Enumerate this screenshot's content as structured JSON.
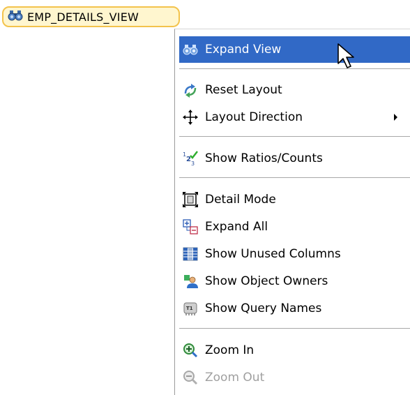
{
  "node": {
    "label": "EMP_DETAILS_VIEW",
    "icon": "binoculars-icon"
  },
  "menu": {
    "expand_view": "Expand View",
    "reset_layout": "Reset Layout",
    "layout_direction": "Layout Direction",
    "show_ratios": "Show Ratios/Counts",
    "detail_mode": "Detail Mode",
    "expand_all": "Expand All",
    "show_unused_columns": "Show Unused Columns",
    "show_object_owners": "Show Object Owners",
    "show_query_names": "Show Query Names",
    "zoom_in": "Zoom In",
    "zoom_out": "Zoom Out"
  },
  "colors": {
    "selection": "#3169c6",
    "node_border": "#f3c34c",
    "node_fill": "#fff6cf",
    "disabled_text": "#a0a0a0"
  }
}
